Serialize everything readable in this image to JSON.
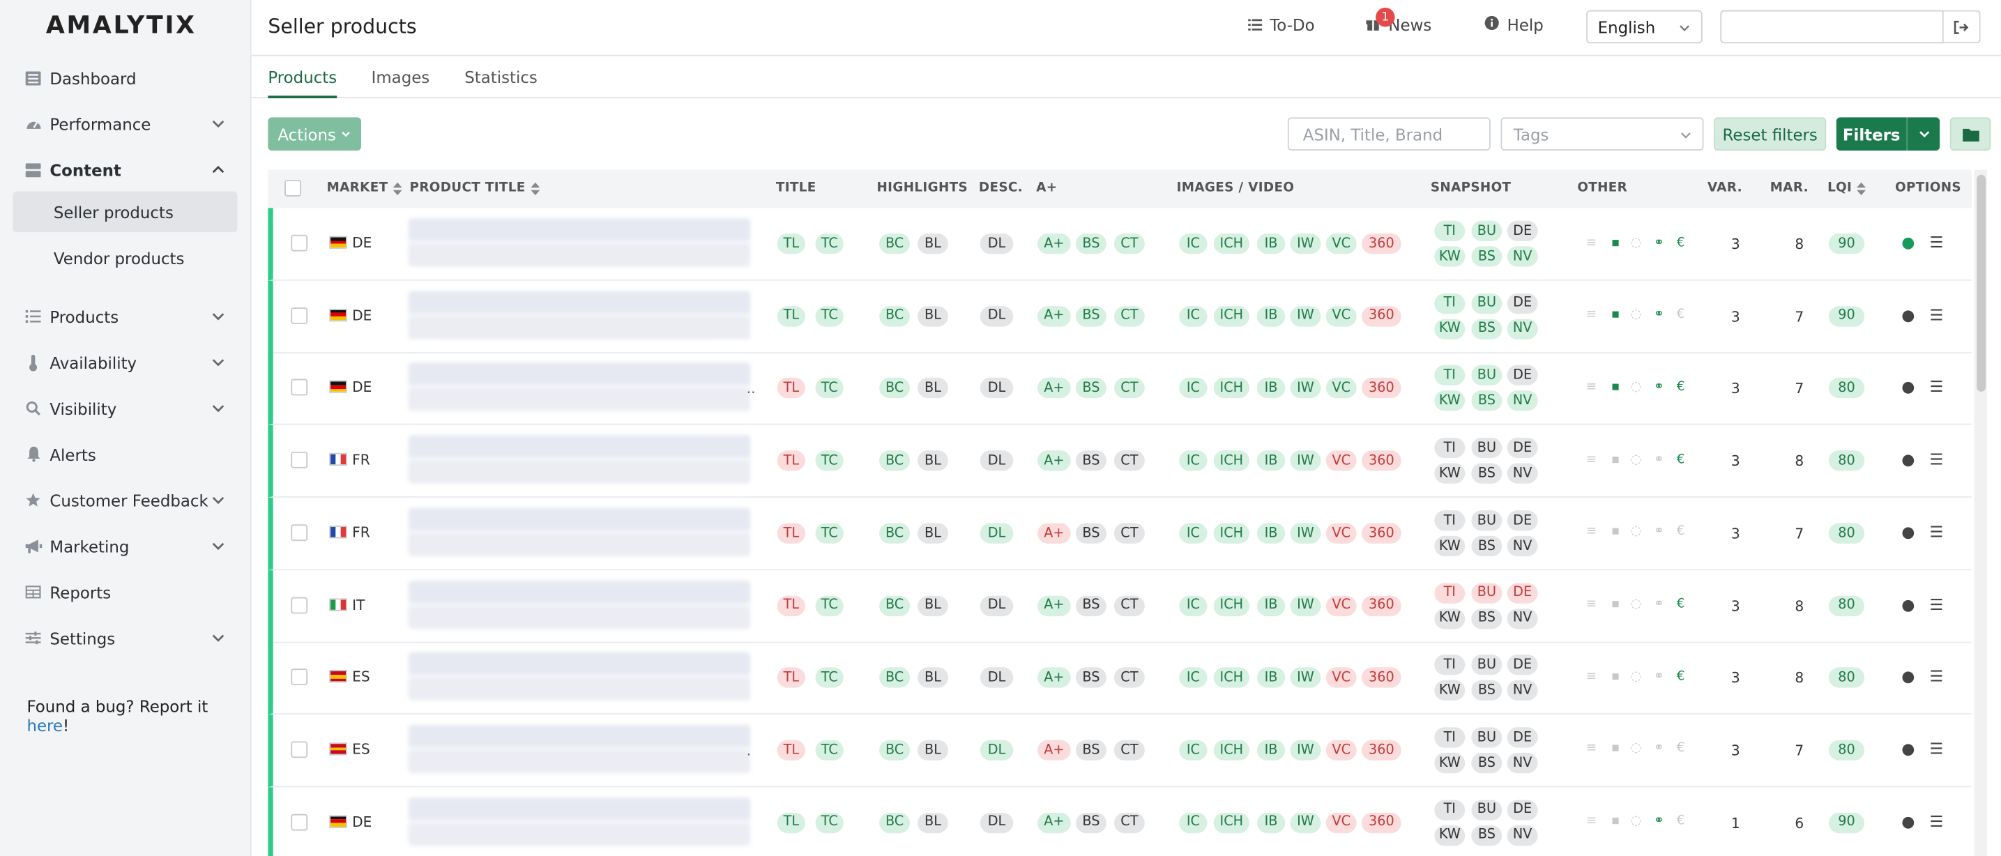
{
  "app": {
    "logo": "AMALYTIX"
  },
  "sidebar": {
    "items": [
      {
        "label": "Dashboard",
        "icon": "dashboard-icon"
      },
      {
        "label": "Performance",
        "icon": "gauge-icon"
      },
      {
        "label": "Content",
        "icon": "content-icon"
      },
      {
        "label": "Products",
        "icon": "list-icon"
      },
      {
        "label": "Availability",
        "icon": "thermometer-icon"
      },
      {
        "label": "Visibility",
        "icon": "search-icon"
      },
      {
        "label": "Alerts",
        "icon": "bell-icon"
      },
      {
        "label": "Customer Feedback",
        "icon": "star-icon"
      },
      {
        "label": "Marketing",
        "icon": "megaphone-icon"
      },
      {
        "label": "Reports",
        "icon": "table-icon"
      },
      {
        "label": "Settings",
        "icon": "sliders-icon"
      }
    ],
    "content_sub": [
      "Seller products",
      "Vendor products"
    ],
    "bug_text": "Found a bug? Report it ",
    "bug_link": "here",
    "bug_end": "!"
  },
  "header": {
    "title": "Seller products",
    "todo": "To-Do",
    "news": "News",
    "news_badge": "1",
    "help": "Help",
    "language": "English"
  },
  "tabs": [
    "Products",
    "Images",
    "Statistics"
  ],
  "toolbar": {
    "actions": "Actions",
    "search_placeholder": "ASIN, Title, Brand",
    "tags_placeholder": "Tags",
    "reset": "Reset filters",
    "filters": "Filters"
  },
  "table": {
    "headers": {
      "market": "MARKET",
      "product_title": "PRODUCT TITLE",
      "title": "TITLE",
      "highlights": "HIGHLIGHTS",
      "desc": "DESC.",
      "aplus": "A+",
      "images": "IMAGES / VIDEO",
      "snapshot": "SNAPSHOT",
      "other": "OTHER",
      "var": "VAR.",
      "mar": "MAR.",
      "lqi": "LQI",
      "options": "OPTIONS"
    },
    "colors": {
      "green": "#237a4b",
      "red": "#c23b3b",
      "gray": "#333333",
      "accent": "#1a7a4c"
    },
    "rows": [
      {
        "market": "DE",
        "flag": "de",
        "dots": "",
        "tl": "g",
        "tc": "g",
        "bc": "g",
        "bl": "gr",
        "dl": "gr",
        "ap": "g",
        "bs": "g",
        "ct": "g",
        "vc": "g",
        "r360": "r",
        "snap": [
          "g",
          "g",
          "gr",
          "g",
          "g",
          "g"
        ],
        "other": [
          0,
          1,
          0,
          1,
          1
        ],
        "var": "3",
        "mar": "8",
        "lqi": "90",
        "comment": "g"
      },
      {
        "market": "DE",
        "flag": "de",
        "dots": "",
        "tl": "g",
        "tc": "g",
        "bc": "g",
        "bl": "gr",
        "dl": "gr",
        "ap": "g",
        "bs": "g",
        "ct": "g",
        "vc": "g",
        "r360": "r",
        "snap": [
          "g",
          "g",
          "gr",
          "g",
          "g",
          "g"
        ],
        "other": [
          0,
          1,
          0,
          1,
          0
        ],
        "var": "3",
        "mar": "7",
        "lqi": "90",
        "comment": "d"
      },
      {
        "market": "DE",
        "flag": "de",
        "dots": "..",
        "tl": "r",
        "tc": "g",
        "bc": "g",
        "bl": "gr",
        "dl": "gr",
        "ap": "g",
        "bs": "g",
        "ct": "g",
        "vc": "g",
        "r360": "r",
        "snap": [
          "g",
          "g",
          "gr",
          "g",
          "g",
          "g"
        ],
        "other": [
          0,
          1,
          0,
          1,
          1
        ],
        "var": "3",
        "mar": "7",
        "lqi": "80",
        "comment": "d"
      },
      {
        "market": "FR",
        "flag": "fr",
        "dots": "",
        "tl": "r",
        "tc": "g",
        "bc": "g",
        "bl": "gr",
        "dl": "gr",
        "ap": "g",
        "bs": "gr",
        "ct": "gr",
        "vc": "r",
        "r360": "r",
        "snap": [
          "gr",
          "gr",
          "gr",
          "gr",
          "gr",
          "gr"
        ],
        "other": [
          0,
          0,
          0,
          0,
          1
        ],
        "var": "3",
        "mar": "8",
        "lqi": "80",
        "comment": "d"
      },
      {
        "market": "FR",
        "flag": "fr",
        "dots": "",
        "tl": "r",
        "tc": "g",
        "bc": "g",
        "bl": "gr",
        "dl": "g",
        "ap": "r",
        "bs": "gr",
        "ct": "gr",
        "vc": "r",
        "r360": "r",
        "snap": [
          "gr",
          "gr",
          "gr",
          "gr",
          "gr",
          "gr"
        ],
        "other": [
          0,
          0,
          0,
          0,
          0
        ],
        "var": "3",
        "mar": "7",
        "lqi": "80",
        "comment": "d"
      },
      {
        "market": "IT",
        "flag": "it",
        "dots": "",
        "tl": "r",
        "tc": "g",
        "bc": "g",
        "bl": "gr",
        "dl": "gr",
        "ap": "g",
        "bs": "gr",
        "ct": "gr",
        "vc": "r",
        "r360": "r",
        "snap": [
          "r",
          "r",
          "r",
          "gr",
          "gr",
          "gr"
        ],
        "other": [
          0,
          0,
          0,
          0,
          1
        ],
        "var": "3",
        "mar": "8",
        "lqi": "80",
        "comment": "d"
      },
      {
        "market": "ES",
        "flag": "es",
        "dots": "",
        "tl": "r",
        "tc": "g",
        "bc": "g",
        "bl": "gr",
        "dl": "gr",
        "ap": "g",
        "bs": "gr",
        "ct": "gr",
        "vc": "r",
        "r360": "r",
        "snap": [
          "gr",
          "gr",
          "gr",
          "gr",
          "gr",
          "gr"
        ],
        "other": [
          0,
          0,
          0,
          0,
          1
        ],
        "var": "3",
        "mar": "8",
        "lqi": "80",
        "comment": "d"
      },
      {
        "market": "ES",
        "flag": "es",
        "dots": ".",
        "tl": "r",
        "tc": "g",
        "bc": "g",
        "bl": "gr",
        "dl": "g",
        "ap": "r",
        "bs": "gr",
        "ct": "gr",
        "vc": "r",
        "r360": "r",
        "snap": [
          "gr",
          "gr",
          "gr",
          "gr",
          "gr",
          "gr"
        ],
        "other": [
          0,
          0,
          0,
          0,
          0
        ],
        "var": "3",
        "mar": "7",
        "lqi": "80",
        "comment": "d"
      },
      {
        "market": "DE",
        "flag": "de",
        "dots": "",
        "tl": "g",
        "tc": "g",
        "bc": "g",
        "bl": "gr",
        "dl": "gr",
        "ap": "g",
        "bs": "gr",
        "ct": "gr",
        "vc": "r",
        "r360": "r",
        "snap": [
          "gr",
          "gr",
          "gr",
          "gr",
          "gr",
          "gr"
        ],
        "other": [
          0,
          0,
          0,
          1,
          0
        ],
        "var": "1",
        "mar": "6",
        "lqi": "90",
        "comment": "d"
      }
    ],
    "labels": {
      "tl": "TL",
      "tc": "TC",
      "bc": "BC",
      "bl": "BL",
      "dl": "DL",
      "ap": "A+",
      "bs": "BS",
      "ct": "CT",
      "ic": "IC",
      "ich": "ICH",
      "ib": "IB",
      "iw": "IW",
      "vc": "VC",
      "r360": "360",
      "snap": [
        "TI",
        "BU",
        "DE",
        "KW",
        "BS",
        "NV"
      ]
    }
  }
}
